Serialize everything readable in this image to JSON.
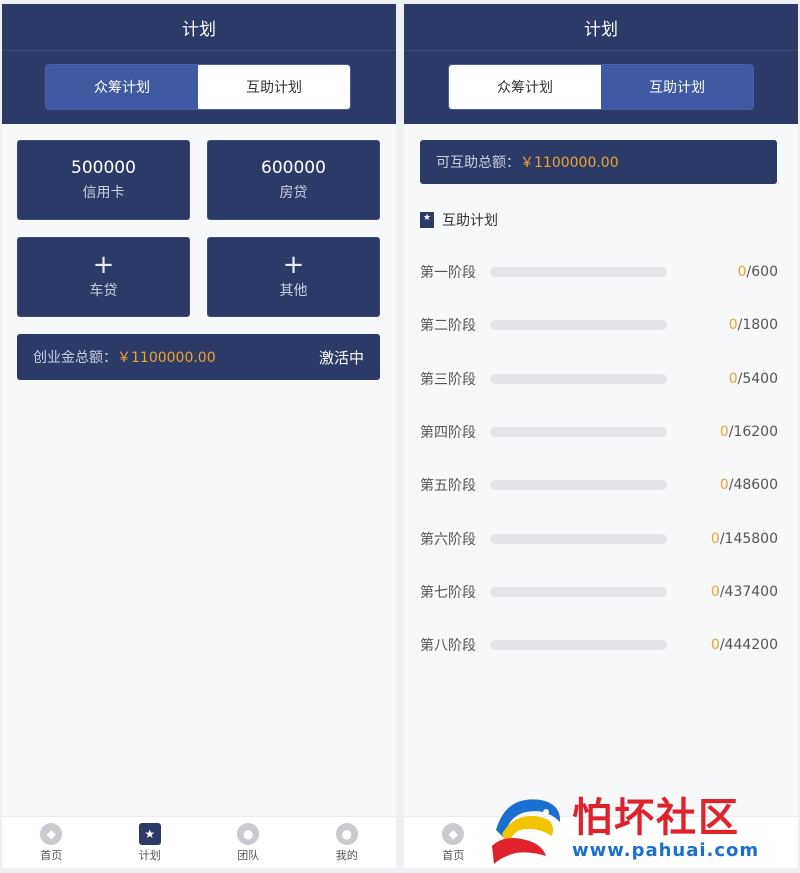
{
  "left": {
    "header_title": "计划",
    "tabs": [
      {
        "label": "众筹计划",
        "active": true
      },
      {
        "label": "互助计划",
        "active": false
      }
    ],
    "cards": [
      {
        "value": "500000",
        "label": "信用卡"
      },
      {
        "value": "600000",
        "label": "房贷"
      },
      {
        "plus": "+",
        "label": "车贷"
      },
      {
        "plus": "+",
        "label": "其他"
      }
    ],
    "total_bar": {
      "label": "创业金总额：",
      "amount": "￥1100000.00",
      "status": "激活中"
    },
    "nav": [
      {
        "label": "首页",
        "icon": "home-icon"
      },
      {
        "label": "计划",
        "icon": "plan-star-icon"
      },
      {
        "label": "团队",
        "icon": "team-icon"
      },
      {
        "label": "我的",
        "icon": "user-icon"
      }
    ]
  },
  "right": {
    "header_title": "计划",
    "tabs": [
      {
        "label": "众筹计划",
        "active": false
      },
      {
        "label": "互助计划",
        "active": true
      }
    ],
    "total_bar": {
      "label": "可互助总额：",
      "amount": "￥1100000.00"
    },
    "section_title": "互助计划",
    "stages": [
      {
        "name": "第一阶段",
        "current": "0",
        "total": "/600",
        "progress": 0
      },
      {
        "name": "第二阶段",
        "current": "0",
        "total": "/1800",
        "progress": 0
      },
      {
        "name": "第三阶段",
        "current": "0",
        "total": "/5400",
        "progress": 0
      },
      {
        "name": "第四阶段",
        "current": "0",
        "total": "/16200",
        "progress": 0
      },
      {
        "name": "第五阶段",
        "current": "0",
        "total": "/48600",
        "progress": 0
      },
      {
        "name": "第六阶段",
        "current": "0",
        "total": "/145800",
        "progress": 0
      },
      {
        "name": "第七阶段",
        "current": "0",
        "total": "/437400",
        "progress": 0
      },
      {
        "name": "第八阶段",
        "current": "0",
        "total": "/444200",
        "progress": 0
      }
    ],
    "nav": [
      {
        "label": "首页",
        "icon": "home-icon"
      }
    ]
  },
  "watermark": {
    "brand": "怕坏社区",
    "url": "www.pahuai.com"
  },
  "colors": {
    "primary": "#2c3a68",
    "accent": "#3f59a3",
    "gold": "#f0a32b",
    "brand_red": "#e0232b",
    "brand_blue": "#1a6fd0"
  }
}
